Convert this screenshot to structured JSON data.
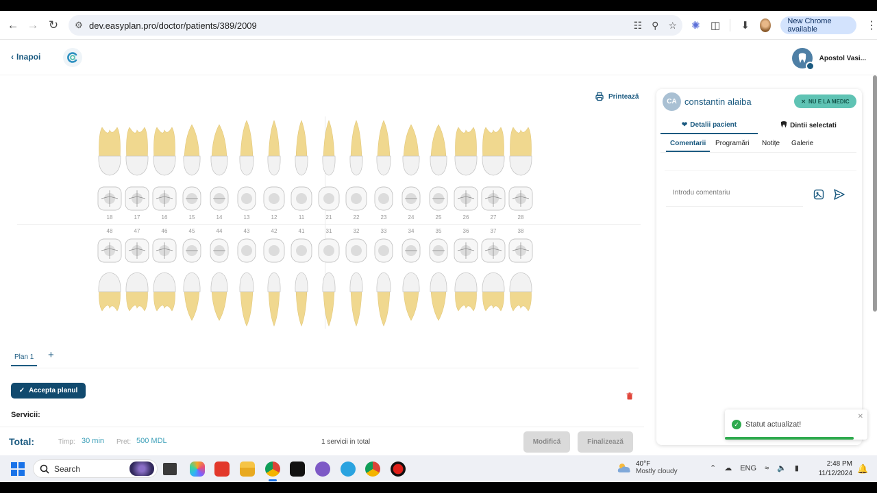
{
  "browser": {
    "url": "dev.easyplan.pro/doctor/patients/389/2009",
    "update_label": "New Chrome available"
  },
  "header": {
    "back_label": "Inapoi",
    "doctor_name": "Apostol Vasi..."
  },
  "chart": {
    "print_label": "Printează",
    "upper_numbers": [
      "18",
      "17",
      "16",
      "15",
      "14",
      "13",
      "12",
      "11",
      "21",
      "22",
      "23",
      "24",
      "25",
      "26",
      "27",
      "28"
    ],
    "lower_numbers": [
      "48",
      "47",
      "46",
      "45",
      "44",
      "43",
      "42",
      "41",
      "31",
      "32",
      "33",
      "34",
      "35",
      "36",
      "37",
      "38"
    ]
  },
  "plan": {
    "tab_label": "Plan 1",
    "add_label": "+",
    "accept_label": "Accepta planul",
    "services_label": "Servicii:"
  },
  "footer": {
    "total_label": "Total:",
    "time_label": "Timp:",
    "time_value": "30 min",
    "price_label": "Pret:",
    "price_value": "500 MDL",
    "services_count": "1 servicii in total",
    "modify_label": "Modifică",
    "finalize_label": "Finalizează"
  },
  "patient": {
    "initials": "CA",
    "name": "constantin alaiba",
    "status": "NU E LA MEDIC",
    "tabs": [
      "Detalii pacient",
      "Dintii selectati"
    ],
    "subtabs": [
      "Comentarii",
      "Programări",
      "Notițe",
      "Galerie"
    ],
    "comment_placeholder": "Introdu comentariu"
  },
  "toast": {
    "message": "Statut actualizat!"
  },
  "taskbar": {
    "search_label": "Search",
    "temperature": "40°F",
    "condition": "Mostly cloudy",
    "language": "ENG",
    "time": "2:48 PM",
    "date": "11/12/2024"
  },
  "colors": {
    "primary": "#1b5a80",
    "accent_teal": "#5fc3b4",
    "success": "#2eaa4d",
    "danger": "#e0453a",
    "tooth_root": "#f0d88f"
  }
}
